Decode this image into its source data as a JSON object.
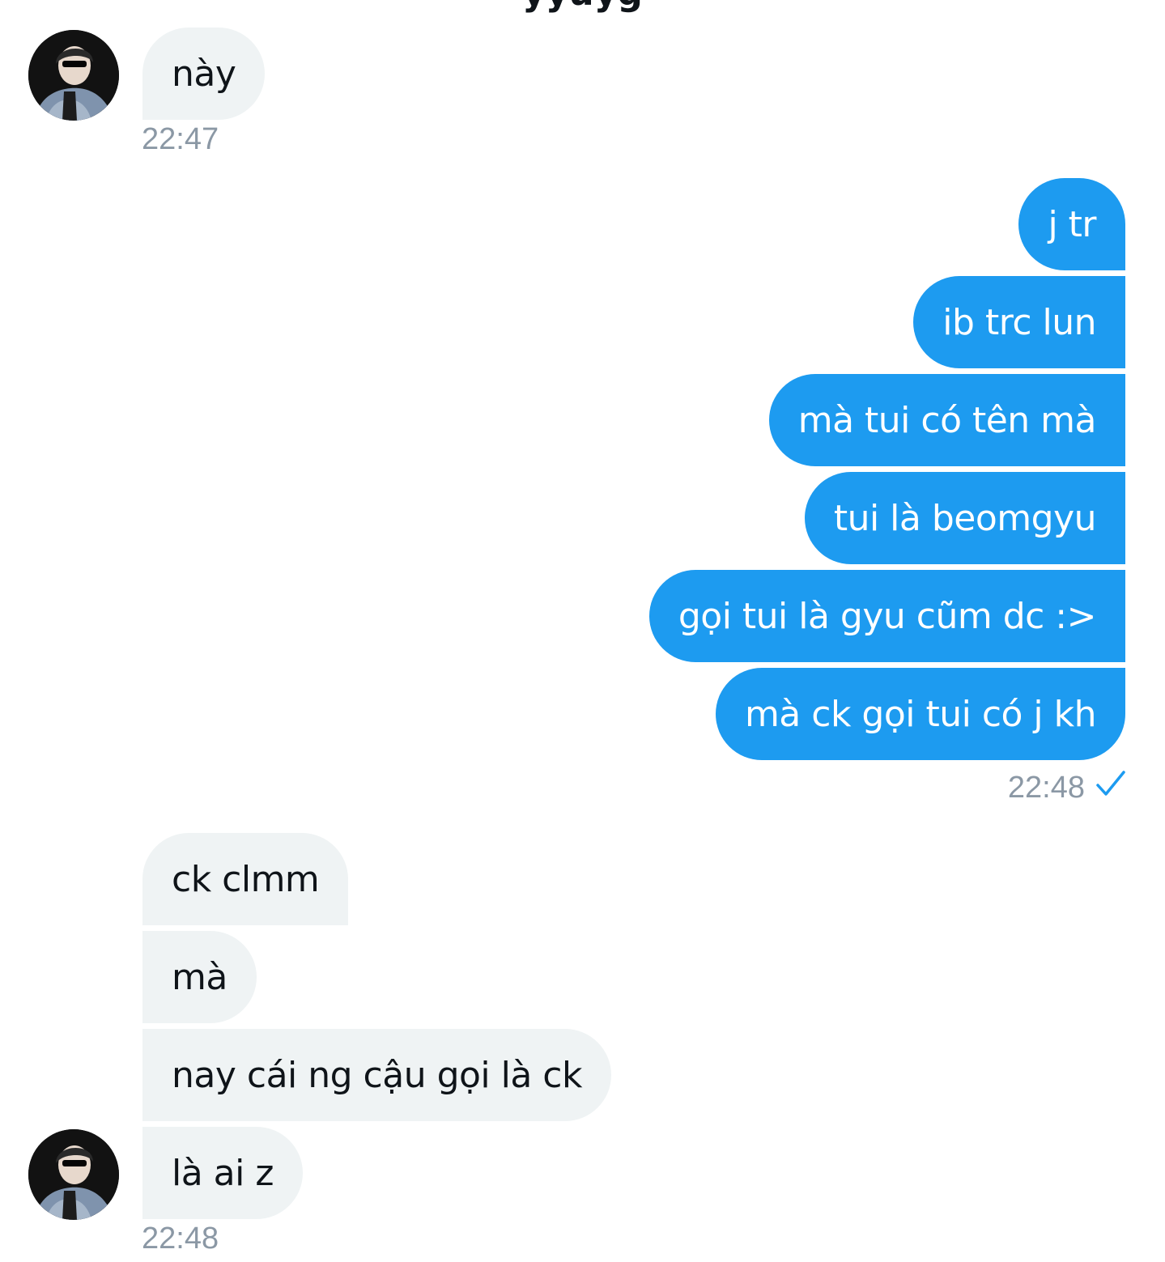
{
  "header": {
    "title_fragment": "yyuyg"
  },
  "colors": {
    "outgoing_bubble": "#1d9bf0",
    "incoming_bubble": "#eff3f4",
    "timestamp": "#8b98a5",
    "read_check": "#1d9bf0"
  },
  "group1": {
    "messages": [
      "này"
    ],
    "time": "22:47"
  },
  "group2": {
    "messages": [
      "j tr",
      "ib trc lun",
      "mà tui có tên mà",
      "tui là beomgyu",
      "gọi tui là gyu cũm dc :>",
      "mà ck gọi tui có j kh"
    ],
    "time": "22:48",
    "status_icon": "check-icon"
  },
  "group3": {
    "messages": [
      "ck clmm",
      "mà",
      "nay cái ng cậu gọi là ck",
      "là ai z"
    ],
    "time": "22:48"
  }
}
